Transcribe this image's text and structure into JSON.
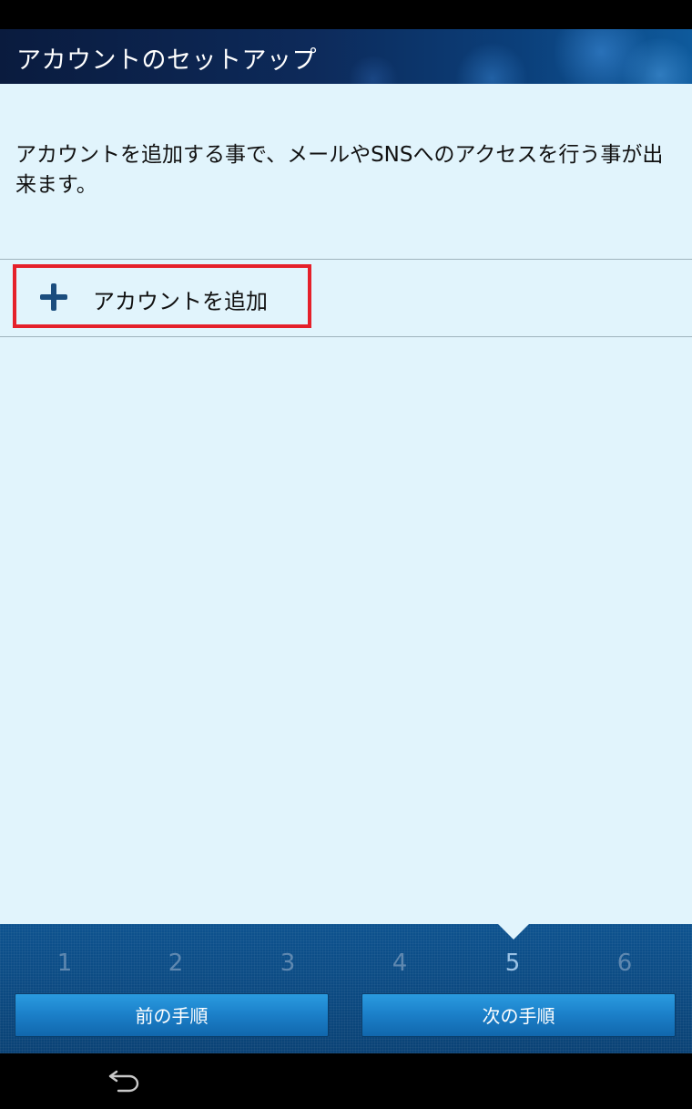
{
  "header": {
    "title": "アカウントのセットアップ"
  },
  "main": {
    "description": "アカウントを追加する事で、メールやSNSへのアクセスを行う事が出来ます。",
    "add_account": {
      "label": "アカウントを追加",
      "icon": "plus-icon",
      "highlight_color": "#e5202a"
    }
  },
  "wizard": {
    "steps": [
      "1",
      "2",
      "3",
      "4",
      "5",
      "6"
    ],
    "current_step": 5,
    "prev_label": "前の手順",
    "next_label": "次の手順"
  },
  "nav": {
    "back_icon": "back-icon"
  },
  "colors": {
    "content_bg": "#e1f4fc",
    "panel_bg": "#0c4b84",
    "button_blue": "#1b7fc8",
    "highlight": "#e5202a"
  }
}
